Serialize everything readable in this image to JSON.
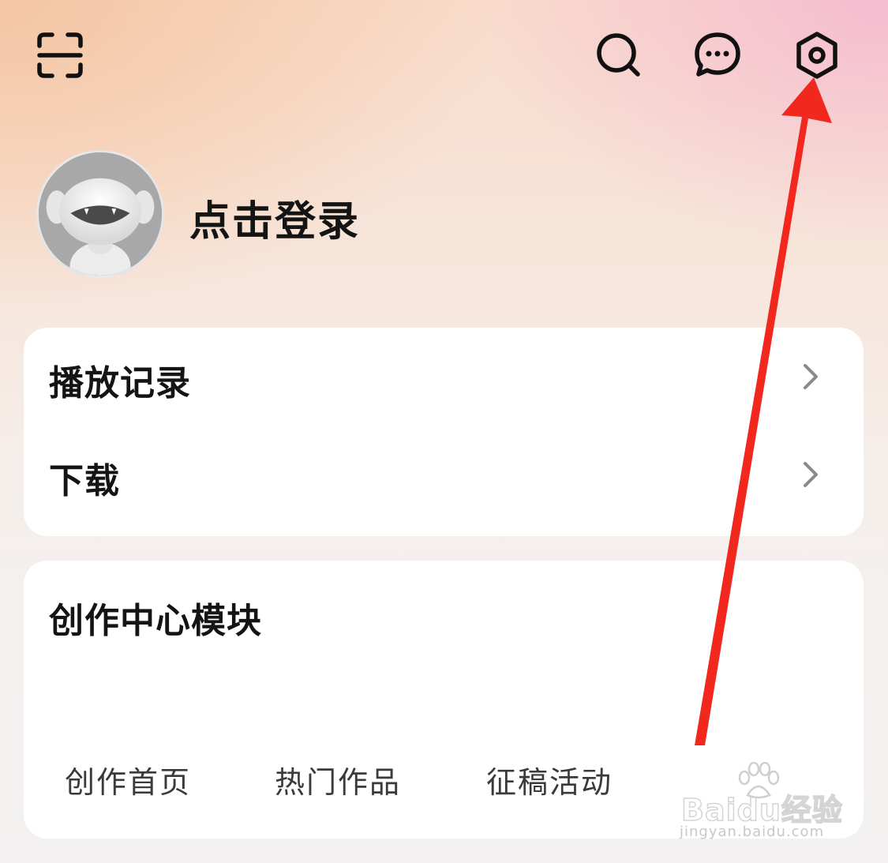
{
  "header": {
    "icons": {
      "scan": "scan-icon",
      "search": "search-icon",
      "messages": "message-icon",
      "settings": "settings-icon"
    }
  },
  "profile": {
    "login_text": "点击登录"
  },
  "records_card": {
    "items": [
      {
        "label": "播放记录"
      },
      {
        "label": "下载"
      }
    ]
  },
  "creator_card": {
    "title": "创作中心模块",
    "tabs": [
      "创作首页",
      "热门作品",
      "征稿活动"
    ]
  },
  "annotation": {
    "arrow_color": "#f2271e"
  },
  "watermark": {
    "brand": "Baidu经验",
    "url": "jingyan.baidu.com"
  }
}
